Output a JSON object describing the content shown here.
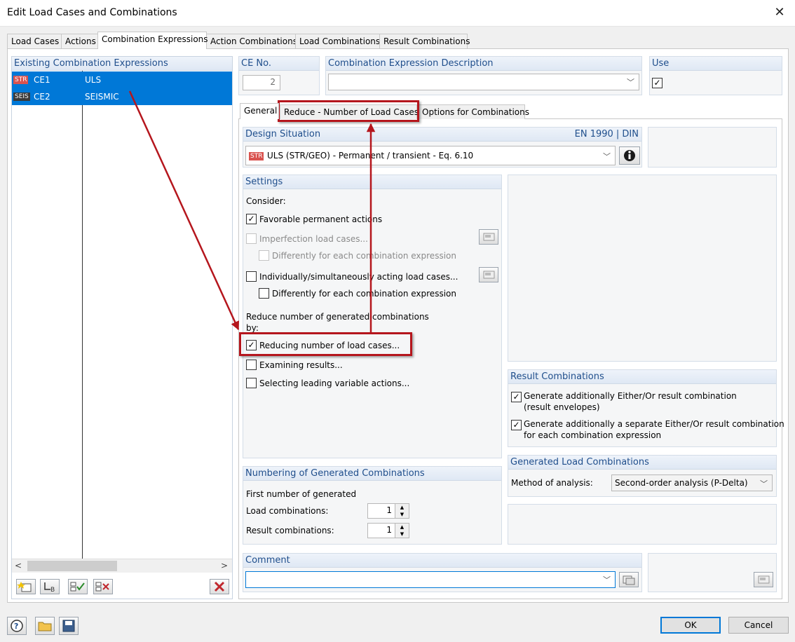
{
  "window": {
    "title": "Edit Load Cases and Combinations"
  },
  "tabs": {
    "load_cases": "Load Cases",
    "actions": "Actions",
    "combination_expressions": "Combination Expressions",
    "action_combinations": "Action Combinations",
    "load_combinations": "Load Combinations",
    "result_combinations": "Result Combinations"
  },
  "existing": {
    "header": "Existing Combination Expressions",
    "rows": [
      {
        "badge": "STR",
        "id": "CE1",
        "name": "ULS"
      },
      {
        "badge": "SEIS",
        "id": "CE2",
        "name": "SEISMIC"
      }
    ]
  },
  "ce_no": {
    "label": "CE No.",
    "value": "2"
  },
  "description": {
    "label": "Combination Expression Description",
    "value": ""
  },
  "use": {
    "label": "Use",
    "checked": "✓"
  },
  "subtabs": {
    "general": "General",
    "reduce": "Reduce - Number of Load Cases",
    "options": "Options for Combinations"
  },
  "design_situation": {
    "label": "Design Situation",
    "standard": "EN 1990 | DIN",
    "badge": "STR",
    "value": "ULS (STR/GEO) - Permanent / transient - Eq. 6.10"
  },
  "settings": {
    "header": "Settings",
    "consider": "Consider:",
    "favorable": {
      "label": "Favorable permanent actions",
      "mark": "✓"
    },
    "imperfection": {
      "label": "Imperfection load cases..."
    },
    "diff1": {
      "label": "Differently for each combination expression"
    },
    "individually": {
      "label": "Individually/simultaneously acting load cases..."
    },
    "diff2": {
      "label": "Differently for each combination expression"
    },
    "reduce_text": "Reduce number of generated combinations by:",
    "reducing": {
      "label": "Reducing number of load cases...",
      "mark": "✓"
    },
    "examining": {
      "label": "Examining results..."
    },
    "selecting": {
      "label": "Selecting leading variable actions..."
    }
  },
  "result_combinations": {
    "header": "Result Combinations",
    "gen1": {
      "label": "Generate additionally Either/Or result combination",
      "sub": "(result envelopes)",
      "mark": "✓"
    },
    "gen2": {
      "label": "Generate additionally a separate Either/Or result combination",
      "sub": "for each combination expression",
      "mark": "✓"
    }
  },
  "numbering": {
    "header": "Numbering of Generated Combinations",
    "first": "First number of generated",
    "load_label": "Load combinations:",
    "load_value": "1",
    "result_label": "Result combinations:",
    "result_value": "1"
  },
  "generated": {
    "header": "Generated Load Combinations",
    "method_label": "Method of analysis:",
    "method_value": "Second-order analysis (P-Delta)"
  },
  "comment": {
    "label": "Comment",
    "value": ""
  },
  "buttons": {
    "ok": "OK",
    "cancel": "Cancel"
  },
  "colors": {
    "selection": "#0078d7",
    "highlight": "#b5161d",
    "group_header": "#1f4e8c"
  }
}
